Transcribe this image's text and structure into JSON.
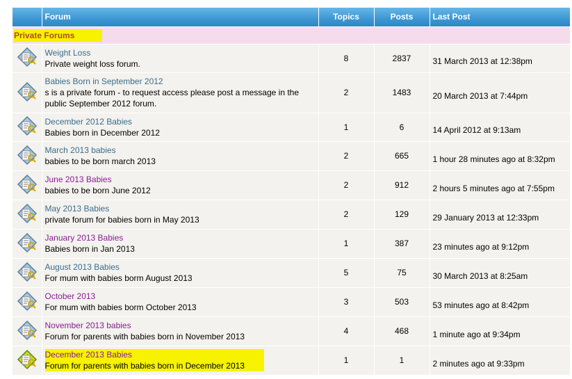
{
  "header": {
    "forum": "Forum",
    "topics": "Topics",
    "posts": "Posts",
    "last_post": "Last Post"
  },
  "section": {
    "title": "Private Forums"
  },
  "forums": [
    {
      "title": "Weight Loss",
      "desc": "Private weight loss forum.",
      "topics": "8",
      "posts": "2837",
      "last_post": "31 March 2013 at 12:38pm",
      "visited": false
    },
    {
      "title": "Babies Born in September 2012",
      "desc": "s is a private forum - to request access please post a message in the public September 2012 forum.",
      "topics": "2",
      "posts": "1483",
      "last_post": "20 March 2013 at 7:44pm",
      "visited": false
    },
    {
      "title": "December 2012 Babies",
      "desc": "Babies born in December 2012",
      "topics": "1",
      "posts": "6",
      "last_post": "14 April 2012 at 9:13am",
      "visited": false
    },
    {
      "title": "March 2013 babies",
      "desc": "babies to be born march 2013",
      "topics": "2",
      "posts": "665",
      "last_post": "1 hour 28 minutes ago at 8:32pm",
      "visited": false
    },
    {
      "title": "June 2013 Babies",
      "desc": "babies to be born June 2012",
      "topics": "2",
      "posts": "912",
      "last_post": "2 hours 5 minutes ago at 7:55pm",
      "visited": true
    },
    {
      "title": "May 2013 Babies",
      "desc": "private forum for babies born in May 2013",
      "topics": "2",
      "posts": "129",
      "last_post": "29 January 2013 at 12:33pm",
      "visited": false
    },
    {
      "title": "January 2013 Babies",
      "desc": "Babies born in Jan 2013",
      "topics": "1",
      "posts": "387",
      "last_post": "23 minutes ago at 9:12pm",
      "visited": true
    },
    {
      "title": "August 2013 Babies",
      "desc": "For mum with babies borm August 2013",
      "topics": "5",
      "posts": "75",
      "last_post": "30 March 2013 at 8:25am",
      "visited": false
    },
    {
      "title": "October 2013",
      "desc": "For mum with babies borm October 2013",
      "topics": "3",
      "posts": "503",
      "last_post": "53 minutes ago at 8:42pm",
      "visited": true
    },
    {
      "title": "November 2013 babies",
      "desc": "Forum for parents with babies born in November 2013",
      "topics": "4",
      "posts": "468",
      "last_post": "1 minute ago at 9:34pm",
      "visited": true
    },
    {
      "title": "December 2013 Babies",
      "desc": "Forum for parents with babies born in December 2013",
      "topics": "1",
      "posts": "1",
      "last_post": "2 minutes ago at 9:33pm",
      "visited": true,
      "highlight": true
    }
  ],
  "colors": {
    "header_blue": "#3d97d3",
    "section_pink": "#f4dced",
    "section_text": "#b24a1e",
    "link": "#3a6d8c",
    "visited_link": "#8a1c95",
    "highlight": "#f6f200"
  },
  "icons": {
    "read": "forum-read-icon",
    "unread": "forum-new-posts-icon"
  }
}
